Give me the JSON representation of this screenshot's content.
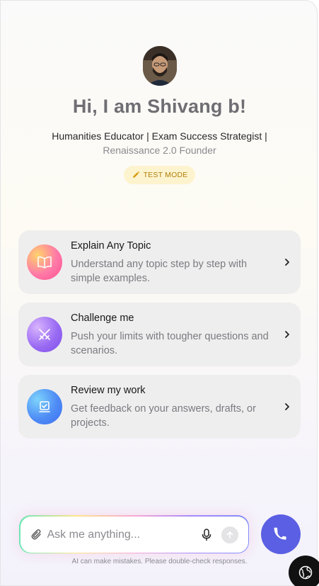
{
  "profile": {
    "greeting": "Hi, I am Shivang b!",
    "tagline": "Humanities Educator | Exam Success Strategist |",
    "tagline_2": "Renaissance 2.0 Founder",
    "badge": "TEST MODE",
    "avatar_icon": "person-photo"
  },
  "cards": [
    {
      "title": "Explain Any Topic",
      "desc": "Understand any topic step by step with simple examples.",
      "icon": "book-icon"
    },
    {
      "title": "Challenge me",
      "desc": "Push your limits with tougher questions and scenarios.",
      "icon": "swords-icon"
    },
    {
      "title": "Review my work",
      "desc": "Get feedback on your answers, drafts, or projects.",
      "icon": "review-icon"
    }
  ],
  "chat": {
    "placeholder": "Ask me anything...",
    "disclaimer": "AI can make mistakes. Please double-check responses."
  },
  "colors": {
    "accent": "#5b5fe3",
    "badge_bg": "#fdf4cf",
    "badge_text": "#b07e0a",
    "card_bg": "#efeeee"
  }
}
